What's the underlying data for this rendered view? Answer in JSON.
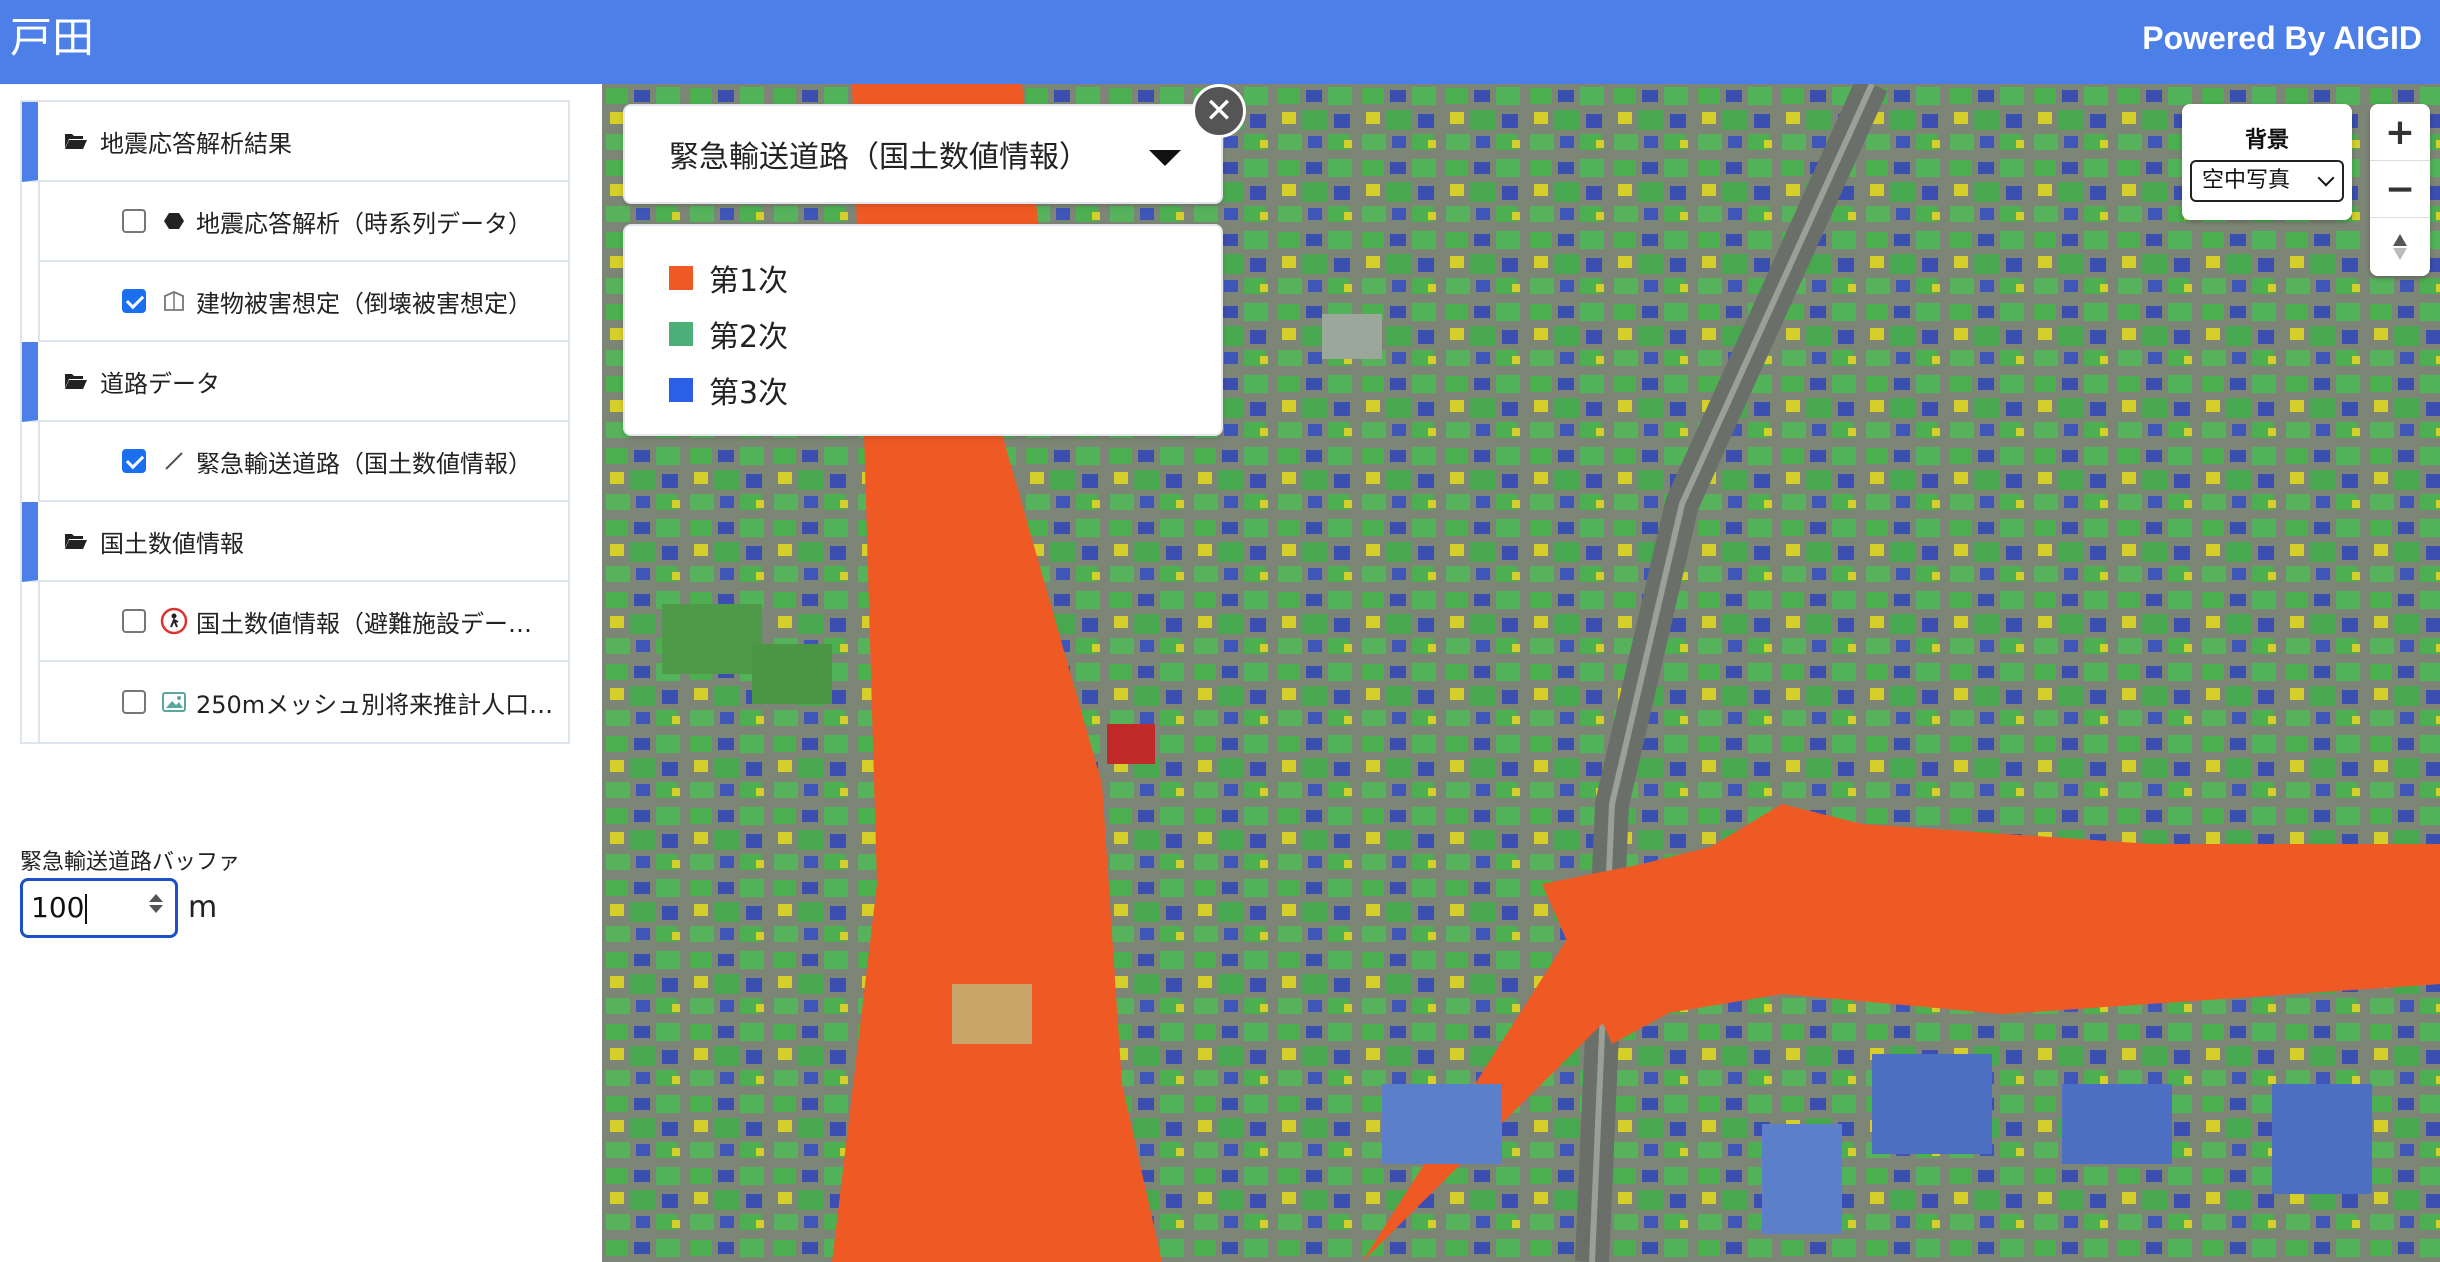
{
  "header": {
    "title": "戸田",
    "powered_by": "Powered By AIGID"
  },
  "sidebar": {
    "groups": [
      {
        "label": "地震応答解析結果",
        "items": [
          {
            "label": "地震応答解析（時系列データ）",
            "checked": false,
            "icon": "hexagon-icon"
          },
          {
            "label": "建物被害想定（倒壊被害想定）",
            "checked": true,
            "icon": "building-icon"
          }
        ]
      },
      {
        "label": "道路データ",
        "items": [
          {
            "label": "緊急輸送道路（国土数値情報）",
            "checked": true,
            "icon": "line-icon"
          }
        ]
      },
      {
        "label": "国土数値情報",
        "items": [
          {
            "label": "国土数値情報（避難施設データ…",
            "checked": false,
            "icon": "evacuation-icon"
          },
          {
            "label": "250mメッシュ別将来推計人口…",
            "checked": false,
            "icon": "image-icon"
          }
        ]
      }
    ],
    "buffer": {
      "label": "緊急輸送道路バッファ",
      "value": "100",
      "unit": "m"
    }
  },
  "legend": {
    "selected": "緊急輸送道路（国土数値情報）",
    "items": [
      {
        "label": "第1次",
        "color": "#ef5a24"
      },
      {
        "label": "第2次",
        "color": "#4caf78"
      },
      {
        "label": "第3次",
        "color": "#2a5fe8"
      }
    ],
    "close_symbol": "✕"
  },
  "background_selector": {
    "title": "背景",
    "selected": "空中写真"
  },
  "zoom": {
    "in_symbol": "+",
    "out_symbol": "−"
  },
  "colors": {
    "header": "#4d7fe8",
    "road_buffer": "#ef5a24",
    "building_green": "#4caf50",
    "building_blue": "#3a4fb0",
    "building_yellow": "#d6cf2a"
  }
}
